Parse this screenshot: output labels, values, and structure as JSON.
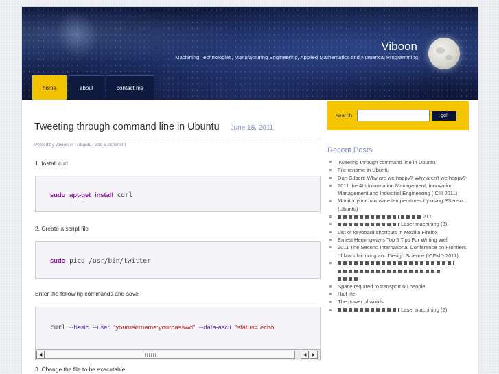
{
  "site": {
    "title": "Viboon",
    "description": "Machining Technologies, Manufacturing Engineering, Applied Mathematics and Numerical Programming"
  },
  "nav": [
    {
      "label": "home",
      "active": true
    },
    {
      "label": "about",
      "active": false
    },
    {
      "label": "contact me",
      "active": false
    }
  ],
  "search": {
    "label": "search",
    "button": "go!"
  },
  "post": {
    "title": "Tweeting through command line in Ubuntu",
    "date": "June 18, 2011",
    "meta": "Posted by viboon in : Ubuntu , add a comment",
    "step1": "1. Install curl",
    "code1": {
      "sudo": "sudo",
      "cmd": "apt-get",
      "install": "install",
      "arg": "curl"
    },
    "step2": "2. Create a script file",
    "code2": {
      "sudo": "sudo",
      "arg": "pico /usr/bin/twitter"
    },
    "step_enter": "Enter the following commands and save",
    "code3": {
      "cmd": "curl",
      "opt1": "--basic",
      "opt2": "--user",
      "cred": "\"yourusername:yourpasswd\"",
      "opt3": "--data-ascii",
      "status": "\"status=`echo"
    },
    "step3": "3. Change the file to be executable"
  },
  "sidebar": {
    "recent_title": "Recent Posts",
    "recent_posts": [
      "Tweeting through command line in Ubuntu",
      "File rename in Ubuntu",
      "Dan Gilbert: Why are we happy? Why aren't we happy?",
      "2011 the 4th Information Management, Innovation Management and Industrial Engineering (ICIII 2011)",
      "Monitor your hardware temperatures by using PSensor (Ubuntu)",
      "217",
      "Laser machining (3)",
      "List of keyboard shortcuts in Mozilla Firefox",
      "Ernest Hemingway's Top 5 Tips For Writing Well",
      "2011 The Second International Conference on Frontiers of Manufacturing and Design Science (ICFMD 2011)",
      "",
      "Space required to transport 60 people",
      "Half life",
      "The power of words",
      "Laser machining (2)"
    ]
  }
}
